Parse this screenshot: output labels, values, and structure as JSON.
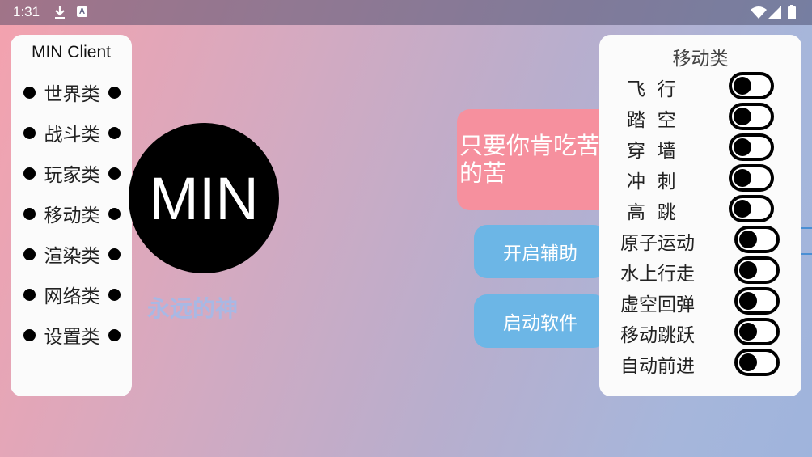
{
  "status_bar": {
    "time": "1:31",
    "icons": [
      "download-icon",
      "a-badge-icon",
      "wifi-icon",
      "signal-icon",
      "battery-icon"
    ],
    "a_badge": "A"
  },
  "left_panel": {
    "title": "MIN Client",
    "items": [
      {
        "label": "世界类"
      },
      {
        "label": "战斗类"
      },
      {
        "label": "玩家类"
      },
      {
        "label": "移动类"
      },
      {
        "label": "渲染类"
      },
      {
        "label": "网络类"
      },
      {
        "label": "设置类"
      }
    ]
  },
  "logo": {
    "text": "MIN",
    "subtitle": "永远的神"
  },
  "banner": {
    "text": "只要你肯吃苦的苦"
  },
  "buttons": {
    "enable_assist": "开启辅助",
    "launch_software": "启动软件"
  },
  "right_panel": {
    "title": "移动类",
    "items": [
      {
        "label": "飞  行",
        "enabled": false
      },
      {
        "label": "踏  空",
        "enabled": false
      },
      {
        "label": "穿  墙",
        "enabled": false
      },
      {
        "label": "冲  刺",
        "enabled": false
      },
      {
        "label": "高  跳",
        "enabled": false
      },
      {
        "label": "原子运动",
        "enabled": false
      },
      {
        "label": "水上行走",
        "enabled": false
      },
      {
        "label": "虚空回弹",
        "enabled": false
      },
      {
        "label": "移动跳跃",
        "enabled": false
      },
      {
        "label": "自动前进",
        "enabled": false
      }
    ]
  },
  "colors": {
    "banner": "#f6909e",
    "button": "#6cb6e6",
    "subtitle": "#a8b8e4",
    "panel": "#fbfbfb"
  }
}
